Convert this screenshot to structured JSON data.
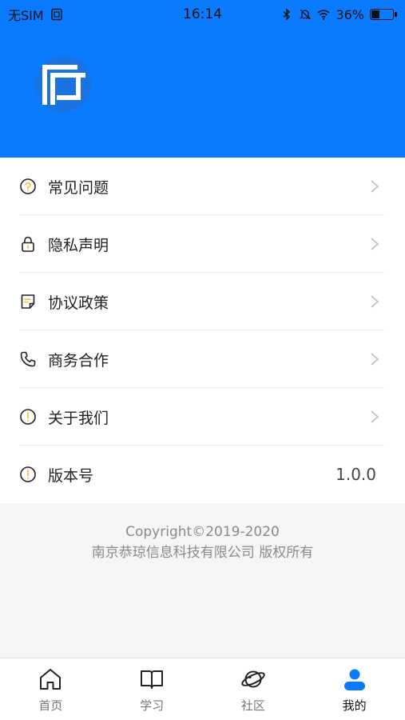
{
  "status_bar": {
    "carrier": "无SIM",
    "time": "16:14",
    "battery": "36%",
    "battery_level": 0.36
  },
  "colors": {
    "brand": "#0a7bff",
    "icon_accent": "#f5c242",
    "tab_active": "#0a7bff"
  },
  "menu": {
    "items": [
      {
        "label": "常见问题",
        "icon": "question-circle-icon"
      },
      {
        "label": "隐私声明",
        "icon": "lock-icon"
      },
      {
        "label": "协议政策",
        "icon": "document-icon"
      },
      {
        "label": "商务合作",
        "icon": "phone-icon"
      },
      {
        "label": "关于我们",
        "icon": "info-circle-icon"
      },
      {
        "label": "版本号",
        "icon": "info-circle-icon",
        "value": "1.0.0"
      }
    ]
  },
  "footer": {
    "copyright_line1": "Copyright©2019-2020",
    "copyright_line2": "南京恭琼信息科技有限公司 版权所有"
  },
  "tabbar": {
    "tabs": [
      {
        "label": "首页",
        "icon": "home-icon"
      },
      {
        "label": "学习",
        "icon": "book-icon"
      },
      {
        "label": "社区",
        "icon": "planet-icon"
      },
      {
        "label": "我的",
        "icon": "user-icon",
        "active": true
      }
    ]
  }
}
